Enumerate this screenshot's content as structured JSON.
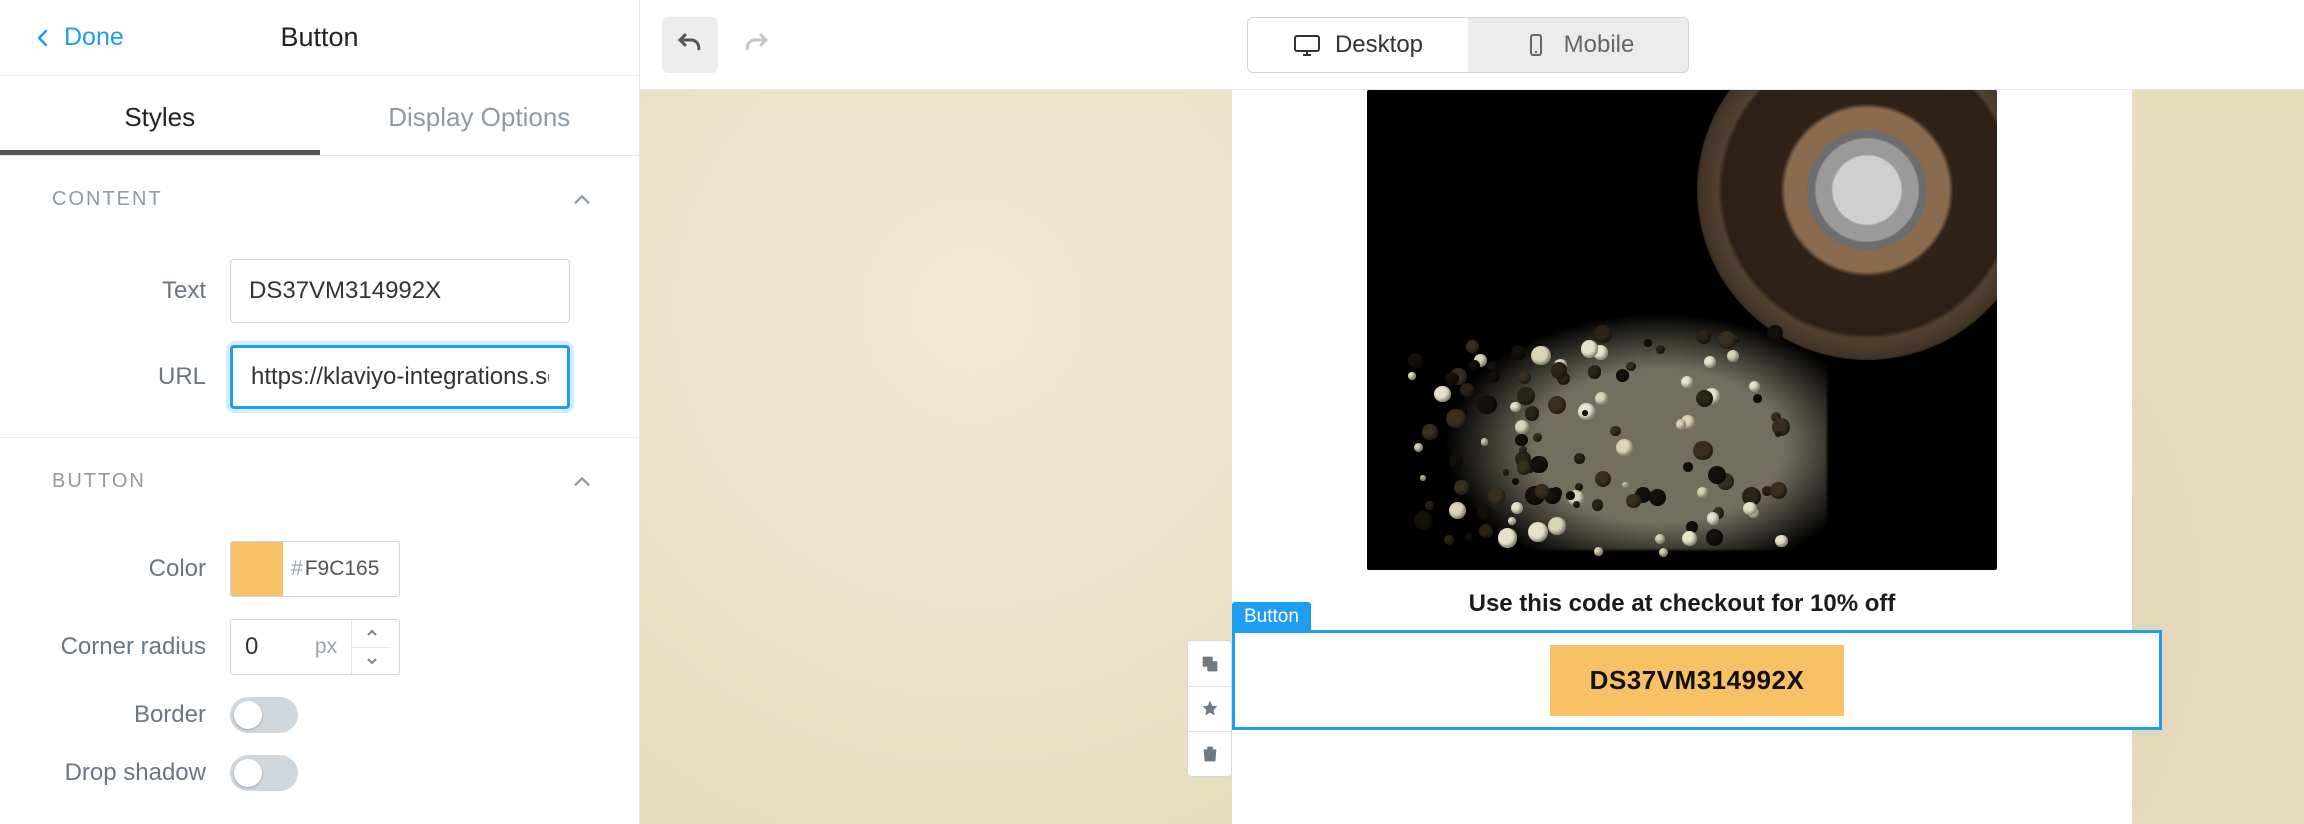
{
  "sidebar": {
    "done_label": "Done",
    "title": "Button",
    "tabs": {
      "styles": "Styles",
      "display_options": "Display Options"
    },
    "sections": {
      "content": {
        "heading": "CONTENT",
        "text_label": "Text",
        "text_value": "DS37VM314992X",
        "url_label": "URL",
        "url_value": "https://klaviyo-integrations.squa"
      },
      "button": {
        "heading": "BUTTON",
        "color_label": "Color",
        "color_hex": "F9C165",
        "radius_label": "Corner radius",
        "radius_value": "0",
        "radius_unit": "px",
        "border_label": "Border",
        "shadow_label": "Drop shadow"
      }
    }
  },
  "topbar": {
    "desktop": "Desktop",
    "mobile": "Mobile"
  },
  "preview": {
    "caption": "Use this code at checkout for 10% off",
    "block_label": "Button",
    "button_text": "DS37VM314992X"
  }
}
